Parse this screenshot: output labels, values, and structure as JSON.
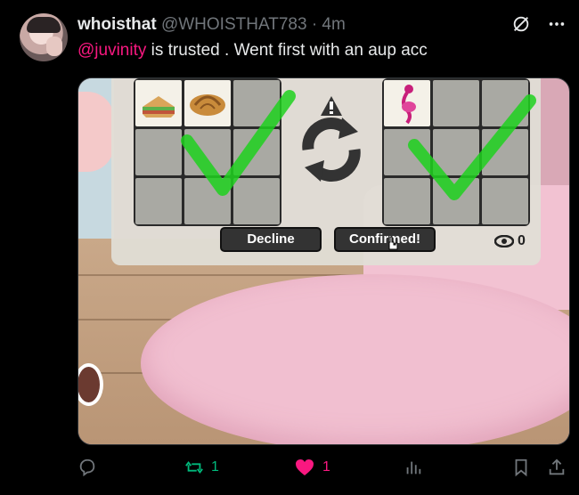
{
  "tweet": {
    "display_name": "whoisthat",
    "handle": "@WHOISTHAT783",
    "separator": "·",
    "time": "4m",
    "mention": "@juvinity",
    "text_rest": " is trusted . Went first with an aup acc"
  },
  "trade_window": {
    "decline_label": "Decline",
    "confirmed_label": "Confirmed!",
    "watchers": "0",
    "left_items": [
      "sandwich-icon",
      "croissant-icon"
    ],
    "right_items": [
      "flamingo-icon"
    ]
  },
  "actions": {
    "reply_count": "",
    "repost_count": "1",
    "like_count": "1",
    "views_count": ""
  },
  "colors": {
    "mention": "#f91880",
    "repost": "#00ba7c",
    "like": "#f91880",
    "check": "#1fd11f"
  }
}
